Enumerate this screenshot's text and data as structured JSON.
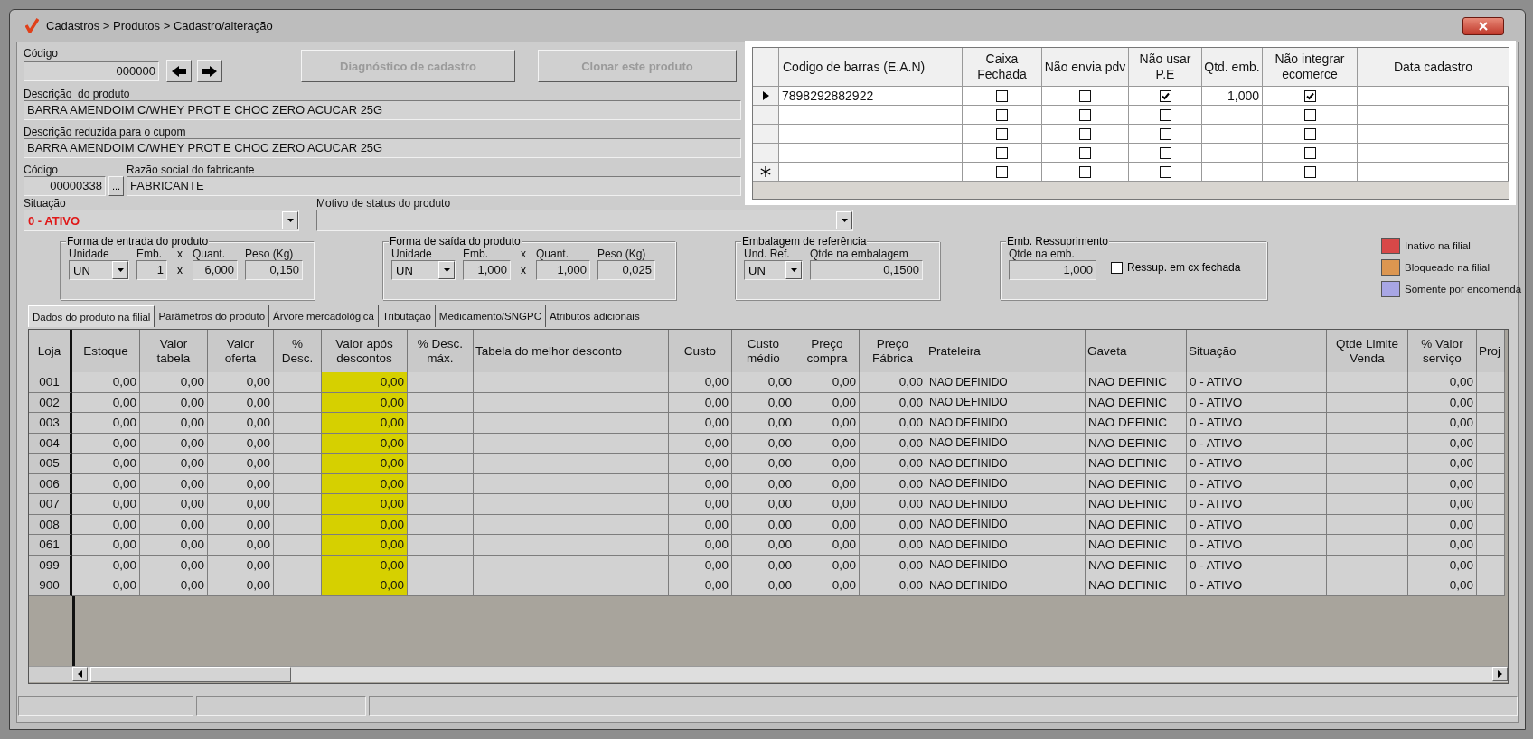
{
  "window": {
    "title": "Cadastros > Produtos > Cadastro/alteração"
  },
  "product": {
    "code": {
      "label": "Código",
      "value": "000000"
    },
    "buttons": [
      {
        "label": "Diagnóstico de cadastro",
        "disabled": true
      },
      {
        "label": "Clonar este produto",
        "disabled": true
      }
    ],
    "description": {
      "label": "Descrição  do produto",
      "value": "BARRA AMENDOIM C/WHEY PROT E CHOC ZERO ACUCAR 25G"
    },
    "receipt_description": {
      "label": "Descrição reduzida para o cupom",
      "value": "BARRA AMENDOIM C/WHEY PROT E CHOC ZERO ACUCAR 25G"
    },
    "manufacturer_code": {
      "label": "Código",
      "value": "00000338",
      "button": "..."
    },
    "manufacturer_name": {
      "label": "Razão social do fabricante",
      "value": "FABRICANTE"
    },
    "status": {
      "label": "Situação",
      "value": "0 - ATIVO"
    },
    "status_reason": {
      "label": "Motivo de status do produto"
    }
  },
  "barcodes": {
    "columns": [
      "Codigo de barras (E.A.N)",
      "Caixa Fechada",
      "Não envia pdv",
      "Não usar P.E",
      "Qtd. emb.",
      "Não integrar ecomerce",
      "Data cadastro"
    ],
    "rows": [
      {
        "selected": true,
        "new_row": false,
        "cells": [
          {
            "kind": "text",
            "value": "7898292882922"
          },
          {
            "kind": "check",
            "checked": false
          },
          {
            "kind": "check",
            "checked": false
          },
          {
            "kind": "check",
            "checked": true
          },
          {
            "kind": "number",
            "value": "1,000"
          },
          {
            "kind": "check",
            "checked": true
          },
          {
            "kind": "text"
          }
        ]
      },
      {
        "selected": false,
        "new_row": false,
        "cells": [
          {
            "kind": "text"
          },
          {
            "kind": "check",
            "checked": false
          },
          {
            "kind": "check",
            "checked": false
          },
          {
            "kind": "check",
            "checked": false
          },
          {
            "kind": "number"
          },
          {
            "kind": "check",
            "checked": false
          },
          {
            "kind": "text"
          }
        ]
      },
      {
        "selected": false,
        "new_row": false,
        "cells": [
          {
            "kind": "text"
          },
          {
            "kind": "check",
            "checked": false
          },
          {
            "kind": "check",
            "checked": false
          },
          {
            "kind": "check",
            "checked": false
          },
          {
            "kind": "number"
          },
          {
            "kind": "check",
            "checked": false
          },
          {
            "kind": "text"
          }
        ]
      },
      {
        "selected": false,
        "new_row": false,
        "cells": [
          {
            "kind": "text"
          },
          {
            "kind": "check",
            "checked": false
          },
          {
            "kind": "check",
            "checked": false
          },
          {
            "kind": "check",
            "checked": false
          },
          {
            "kind": "number"
          },
          {
            "kind": "check",
            "checked": false
          },
          {
            "kind": "text"
          }
        ]
      },
      {
        "selected": false,
        "new_row": true,
        "cells": [
          {
            "kind": "text"
          },
          {
            "kind": "check",
            "checked": false
          },
          {
            "kind": "check",
            "checked": false
          },
          {
            "kind": "check",
            "checked": false
          },
          {
            "kind": "number"
          },
          {
            "kind": "check",
            "checked": false
          },
          {
            "kind": "text"
          }
        ]
      }
    ]
  },
  "groups": [
    {
      "title": "Forma de entrada do produto",
      "fields": [
        {
          "kind": "dropdown",
          "label": "Unidade",
          "value": "UN"
        },
        {
          "kind": "input",
          "label": "Emb.",
          "value": "1"
        },
        {
          "kind": "times",
          "label": "x",
          "value": "x"
        },
        {
          "kind": "input",
          "label": "Quant.",
          "value": "6,000"
        },
        {
          "kind": "input",
          "label": "Peso (Kg)",
          "value": "0,150"
        }
      ]
    },
    {
      "title": "Forma de saída do produto",
      "fields": [
        {
          "kind": "dropdown",
          "label": "Unidade",
          "value": "UN"
        },
        {
          "kind": "input",
          "label": "Emb.",
          "value": "1,000"
        },
        {
          "kind": "times",
          "label": "x",
          "value": "x"
        },
        {
          "kind": "input",
          "label": "Quant.",
          "value": "1,000"
        },
        {
          "kind": "input",
          "label": "Peso (Kg)",
          "value": "0,025"
        }
      ]
    },
    {
      "title": "Embalagem de referência",
      "fields": [
        {
          "kind": "dropdown",
          "label": "Und. Ref.",
          "value": "UN"
        },
        {
          "kind": "input",
          "label": "Qtde na embalagem",
          "value": "0,1500"
        }
      ]
    },
    {
      "title": "Emb. Ressuprimento",
      "fields": [
        {
          "kind": "input",
          "label": "Qtde na emb.",
          "value": "1,000"
        },
        {
          "kind": "checkbox",
          "label": "Ressup. em cx fechada",
          "checked": false
        }
      ]
    }
  ],
  "legend": [
    {
      "label": "Inativo na filial",
      "color": "#d84848"
    },
    {
      "label": "Bloqueado na filial",
      "color": "#dc9650"
    },
    {
      "label": "Somente por encomenda",
      "color": "#a8a6e4"
    }
  ],
  "tabs": [
    {
      "label": "Dados do produto na filial",
      "selected": true
    },
    {
      "label": "Parâmetros do produto",
      "selected": false
    },
    {
      "label": "Árvore mercadológica",
      "selected": false
    },
    {
      "label": "Tributação",
      "selected": false
    },
    {
      "label": "Medicamento/SNGPC",
      "selected": false
    },
    {
      "label": "Atributos adicionais",
      "selected": false
    }
  ],
  "grid": {
    "columns": [
      {
        "label": "Loja",
        "kind": "key",
        "highlighted": false
      },
      {
        "label": "Estoque",
        "kind": "number",
        "highlighted": false
      },
      {
        "label": "Valor tabela",
        "kind": "number",
        "highlighted": false
      },
      {
        "label": "Valor oferta",
        "kind": "number",
        "highlighted": false
      },
      {
        "label": "% Desc.",
        "kind": "number",
        "highlighted": false
      },
      {
        "label": "Valor após descontos",
        "kind": "number",
        "highlighted": true
      },
      {
        "label": "% Desc. máx.",
        "kind": "number",
        "highlighted": false
      },
      {
        "label": "Tabela do melhor desconto",
        "kind": "text",
        "highlighted": false
      },
      {
        "label": "Custo",
        "kind": "number",
        "highlighted": false
      },
      {
        "label": "Custo médio",
        "kind": "number",
        "highlighted": false
      },
      {
        "label": "Preço compra",
        "kind": "number",
        "highlighted": false
      },
      {
        "label": "Preço Fábrica",
        "kind": "number",
        "highlighted": false
      },
      {
        "label": "Prateleira",
        "kind": "text",
        "highlighted": false
      },
      {
        "label": "Gaveta",
        "kind": "text",
        "highlighted": false
      },
      {
        "label": "Situação",
        "kind": "text",
        "highlighted": false
      },
      {
        "label": "Qtde Limite Venda",
        "kind": "number",
        "highlighted": false
      },
      {
        "label": "% Valor serviço",
        "kind": "number",
        "highlighted": false
      },
      {
        "label": "Proj",
        "kind": "text",
        "highlighted": false
      }
    ],
    "rows": [
      {
        "cells": [
          "001",
          "0,00",
          "0,00",
          "0,00",
          null,
          "0,00",
          null,
          null,
          "0,00",
          "0,00",
          "0,00",
          "0,00",
          "NAO DEFINIDO",
          "NAO DEFINIC",
          "0 - ATIVO",
          null,
          "0,00",
          null
        ]
      },
      {
        "cells": [
          "002",
          "0,00",
          "0,00",
          "0,00",
          null,
          "0,00",
          null,
          null,
          "0,00",
          "0,00",
          "0,00",
          "0,00",
          "NAO DEFINIDO",
          "NAO DEFINIC",
          "0 - ATIVO",
          null,
          "0,00",
          null
        ]
      },
      {
        "cells": [
          "003",
          "0,00",
          "0,00",
          "0,00",
          null,
          "0,00",
          null,
          null,
          "0,00",
          "0,00",
          "0,00",
          "0,00",
          "NAO DEFINIDO",
          "NAO DEFINIC",
          "0 - ATIVO",
          null,
          "0,00",
          null
        ]
      },
      {
        "cells": [
          "004",
          "0,00",
          "0,00",
          "0,00",
          null,
          "0,00",
          null,
          null,
          "0,00",
          "0,00",
          "0,00",
          "0,00",
          "NAO DEFINIDO",
          "NAO DEFINIC",
          "0 - ATIVO",
          null,
          "0,00",
          null
        ]
      },
      {
        "cells": [
          "005",
          "0,00",
          "0,00",
          "0,00",
          null,
          "0,00",
          null,
          null,
          "0,00",
          "0,00",
          "0,00",
          "0,00",
          "NAO DEFINIDO",
          "NAO DEFINIC",
          "0 - ATIVO",
          null,
          "0,00",
          null
        ]
      },
      {
        "cells": [
          "006",
          "0,00",
          "0,00",
          "0,00",
          null,
          "0,00",
          null,
          null,
          "0,00",
          "0,00",
          "0,00",
          "0,00",
          "NAO DEFINIDO",
          "NAO DEFINIC",
          "0 - ATIVO",
          null,
          "0,00",
          null
        ]
      },
      {
        "cells": [
          "007",
          "0,00",
          "0,00",
          "0,00",
          null,
          "0,00",
          null,
          null,
          "0,00",
          "0,00",
          "0,00",
          "0,00",
          "NAO DEFINIDO",
          "NAO DEFINIC",
          "0 - ATIVO",
          null,
          "0,00",
          null
        ]
      },
      {
        "cells": [
          "008",
          "0,00",
          "0,00",
          "0,00",
          null,
          "0,00",
          null,
          null,
          "0,00",
          "0,00",
          "0,00",
          "0,00",
          "NAO DEFINIDO",
          "NAO DEFINIC",
          "0 - ATIVO",
          null,
          "0,00",
          null
        ]
      },
      {
        "cells": [
          "061",
          "0,00",
          "0,00",
          "0,00",
          null,
          "0,00",
          null,
          null,
          "0,00",
          "0,00",
          "0,00",
          "0,00",
          "NAO DEFINIDO",
          "NAO DEFINIC",
          "0 - ATIVO",
          null,
          "0,00",
          null
        ]
      },
      {
        "cells": [
          "099",
          "0,00",
          "0,00",
          "0,00",
          null,
          "0,00",
          null,
          null,
          "0,00",
          "0,00",
          "0,00",
          "0,00",
          "NAO DEFINIDO",
          "NAO DEFINIC",
          "0 - ATIVO",
          null,
          "0,00",
          null
        ]
      },
      {
        "cells": [
          "900",
          "0,00",
          "0,00",
          "0,00",
          null,
          "0,00",
          null,
          null,
          "0,00",
          "0,00",
          "0,00",
          "0,00",
          "NAO DEFINIDO",
          "NAO DEFINIC",
          "0 - ATIVO",
          null,
          "0,00",
          null
        ]
      }
    ]
  }
}
